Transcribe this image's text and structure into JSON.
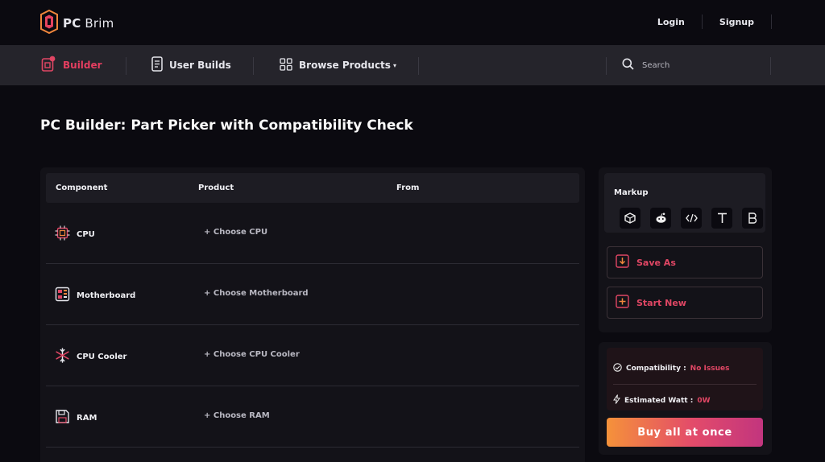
{
  "brand": {
    "name_bold": "PC",
    "name_rest": " Brim"
  },
  "auth": {
    "login": "Login",
    "signup": "Signup"
  },
  "nav": {
    "builder": "Builder",
    "user_builds": "User Builds",
    "browse_products": "Browse Products",
    "search_placeholder": "Search"
  },
  "page": {
    "title": "PC Builder: Part Picker with Compatibility Check"
  },
  "table": {
    "headers": [
      "Component",
      "Product",
      "From"
    ],
    "rows": [
      {
        "component": "CPU",
        "action": "+ Choose CPU",
        "icon": "cpu-icon"
      },
      {
        "component": "Motherboard",
        "action": "+ Choose Motherboard",
        "icon": "motherboard-icon"
      },
      {
        "component": "CPU Cooler",
        "action": "+ Choose CPU Cooler",
        "icon": "snowflake-icon"
      },
      {
        "component": "RAM",
        "action": "+ Choose RAM",
        "icon": "memory-icon"
      }
    ]
  },
  "markup": {
    "label": "Markup",
    "icons": [
      "box-icon",
      "reddit-icon",
      "code-icon",
      "text-icon",
      "bold-icon"
    ]
  },
  "actions": {
    "save_as": "Save As",
    "start_new": "Start New"
  },
  "status": {
    "compat_label": "Compatibility :",
    "compat_value": "No Issues",
    "watt_label": "Estimated Watt :",
    "watt_value": "0W"
  },
  "buy": {
    "label": "Buy all at once"
  },
  "colors": {
    "accent": "#e04664",
    "nav_bg": "#25242b",
    "page_bg": "#0b0a10",
    "gradient_start": "#f5923a",
    "gradient_end": "#c2357e"
  }
}
